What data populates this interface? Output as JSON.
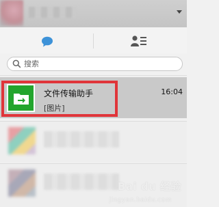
{
  "tabs": {
    "chat_icon": "chat-bubble-icon",
    "contacts_icon": "contacts-icon"
  },
  "search": {
    "placeholder": "搜索",
    "icon": "search-icon"
  },
  "conversations": [
    {
      "title": "文件传输助手",
      "subtitle": "[图片]",
      "time": "16:04",
      "avatar_icon": "folder-transfer-icon",
      "avatar_color": "#23a52d",
      "selected": true
    }
  ],
  "colors": {
    "highlight_border": "#e0353a",
    "selected_bg": "#c9c9c9"
  },
  "watermark": {
    "text": "Bai du 经验",
    "sub": "jingyan.baidu.com"
  }
}
